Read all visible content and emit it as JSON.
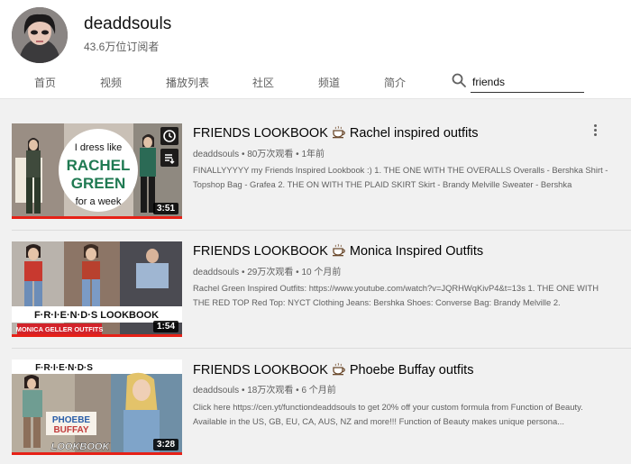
{
  "channel": {
    "name": "deaddsouls",
    "subscribers": "43.6万位订阅者"
  },
  "tabs": [
    "首页",
    "视频",
    "播放列表",
    "社区",
    "频道",
    "简介"
  ],
  "search": {
    "value": "friends"
  },
  "colors": {
    "progress": "#e62117",
    "text_primary": "#030303",
    "text_secondary": "#606060",
    "background": "#f1f1f1"
  },
  "videos": [
    {
      "title_a": "FRIENDS LOOKBOOK",
      "title_b": "Rachel inspired outfits",
      "channel": "deaddsouls",
      "views": "80万次观看",
      "age": "1年前",
      "duration": "3:51",
      "thumb_text": [
        "I dress like",
        "RACHEL",
        "GREEN",
        "for a week"
      ],
      "description": "FINALLYYYYY my Friends Inspired Lookbook :) 1. THE ONE WITH THE OVERALLS Overalls - Bershka Shirt - Topshop Bag - Grafea 2. THE ON WITH THE PLAID SKIRT Skirt - Brandy Melville Sweater - Bershka"
    },
    {
      "title_a": "FRIENDS LOOKBOOK",
      "title_b": "Monica Inspired Outfits",
      "channel": "deaddsouls",
      "views": "29万次观看",
      "age": "10 个月前",
      "duration": "1:54",
      "thumb_text": [
        "F·R·I·E·N·D·S LOOKBOOK",
        "MONICA GELLER OUTFITS"
      ],
      "description": "Rachel Green Inspired Outfits: https://www.youtube.com/watch?v=JQRHWqKivP4&t=13s 1. THE ONE WITH THE RED TOP Red Top: NYCT Clothing Jeans: Bershka Shoes: Converse Bag: Brandy Melville 2."
    },
    {
      "title_a": "FRIENDS LOOKBOOK",
      "title_b": "Phoebe Buffay outfits",
      "channel": "deaddsouls",
      "views": "18万次观看",
      "age": "6 个月前",
      "duration": "3:28",
      "thumb_text": [
        "F·R·I·E·N·D·S",
        "PHOEBE",
        "BUFFAY",
        "LOOKBOOK"
      ],
      "description": "Click here https://cen.yt/functiondeaddsouls to get 20% off your custom formula from Function of Beauty. Available in the US, GB, EU, CA, AUS, NZ and more!!! Function of Beauty makes unique persona..."
    }
  ],
  "meta_sep": "•"
}
